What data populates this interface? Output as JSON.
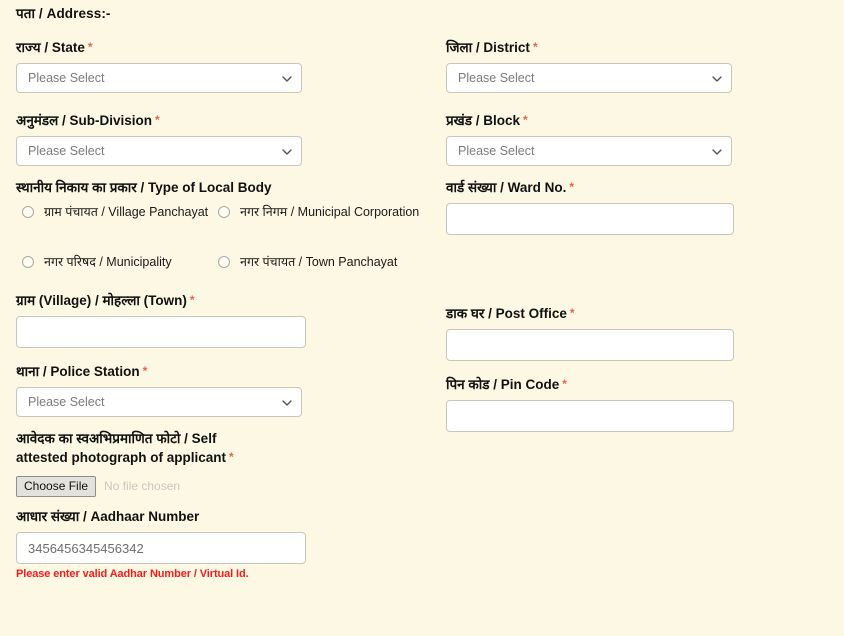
{
  "section": {
    "title": "पता / Address:-"
  },
  "required_marker": "*",
  "colors": {
    "page_background": "#fdf8e3",
    "input_background": "#ffffff",
    "input_border": "#ccc5bb",
    "label_text": "#111111",
    "required_asterisk": "#e8604c",
    "placeholder_text": "#7b7b78",
    "error_text": "#f71c1c",
    "file_button_background": "#e4e2dd"
  },
  "left_column": {
    "state": {
      "label": "राज्य / State",
      "required": true,
      "control": "select",
      "value": "Please Select"
    },
    "sub_division": {
      "label": "अनुमंडल / Sub-Division",
      "required": true,
      "control": "select",
      "value": "Please Select"
    },
    "local_body": {
      "label": "स्थानीय निकाय का प्रकार / Type of Local Body",
      "required": false,
      "control": "radio-group",
      "selected": null,
      "options": [
        {
          "label": "ग्राम पंचायत / Village Panchayat",
          "checked": false
        },
        {
          "label": "नगर निगम / Municipal Corporation",
          "checked": false
        },
        {
          "label": "नगर परिषद / Municipality",
          "checked": false
        },
        {
          "label": "नगर पंचायत / Town Panchayat",
          "checked": false
        }
      ]
    },
    "village_town": {
      "label": "ग्राम (Village) / मोहल्ला (Town)",
      "required": true,
      "control": "text",
      "value": "",
      "placeholder": ""
    },
    "police_station": {
      "label": "थाना / Police Station",
      "required": true,
      "control": "select",
      "value": "Please Select"
    },
    "photograph": {
      "label": "आवेदक का स्वअभिप्रमाणित फोटो / Self attested photograph of applicant",
      "required": true,
      "control": "file",
      "button_label": "Choose File",
      "file_status": "No file chosen"
    },
    "aadhaar": {
      "label": "आधार संख्या / Aadhaar Number",
      "required": false,
      "control": "text",
      "value": "3456456345456342",
      "placeholder": "",
      "error": "Please enter valid Aadhar Number / Virtual Id."
    }
  },
  "right_column": {
    "district": {
      "label": "जिला / District",
      "required": true,
      "control": "select",
      "value": "Please Select"
    },
    "block": {
      "label": "प्रखंड / Block",
      "required": true,
      "control": "select",
      "value": "Please Select"
    },
    "ward_no": {
      "label": "वार्ड संख्या / Ward No.",
      "required": true,
      "control": "text",
      "value": "",
      "placeholder": ""
    },
    "post_office": {
      "label": "डाक घर / Post Office",
      "required": true,
      "control": "text",
      "value": "",
      "placeholder": ""
    },
    "pin_code": {
      "label": "पिन कोड / Pin Code",
      "required": true,
      "control": "text",
      "value": "",
      "placeholder": ""
    }
  }
}
